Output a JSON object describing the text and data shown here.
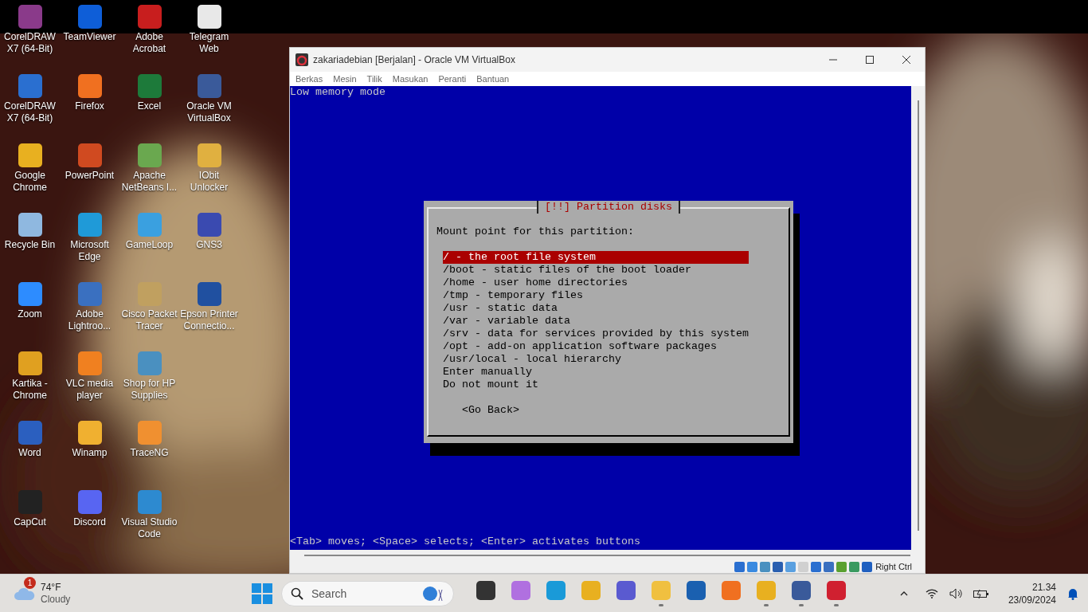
{
  "desktop_icons": [
    {
      "label": "CorelDRAW X7 (64-Bit)"
    },
    {
      "label": "CorelDRAW X7 (64-Bit)"
    },
    {
      "label": "Google Chrome"
    },
    {
      "label": "Recycle Bin"
    },
    {
      "label": "Zoom"
    },
    {
      "label": "Kartika - Chrome"
    },
    {
      "label": "Word"
    },
    {
      "label": "CapCut"
    },
    {
      "label": "TeamViewer"
    },
    {
      "label": "Firefox"
    },
    {
      "label": "PowerPoint"
    },
    {
      "label": "Microsoft Edge"
    },
    {
      "label": "Adobe Lightroo..."
    },
    {
      "label": "VLC media player"
    },
    {
      "label": "Winamp"
    },
    {
      "label": "Discord"
    },
    {
      "label": "Adobe Acrobat"
    },
    {
      "label": "Excel"
    },
    {
      "label": "Apache NetBeans I..."
    },
    {
      "label": "GameLoop"
    },
    {
      "label": "Cisco Packet Tracer"
    },
    {
      "label": "Shop for HP Supplies"
    },
    {
      "label": "TraceNG"
    },
    {
      "label": "Visual Studio Code"
    },
    {
      "label": "Telegram Web"
    },
    {
      "label": "Oracle VM VirtualBox"
    },
    {
      "label": "IObit Unlocker"
    },
    {
      "label": "GNS3"
    },
    {
      "label": "Epson Printer Connectio..."
    }
  ],
  "vm_window": {
    "title": "zakariadebian [Berjalan] - Oracle VM VirtualBox",
    "menu": [
      "Berkas",
      "Mesin",
      "Tilik",
      "Masukan",
      "Peranti",
      "Bantuan"
    ],
    "console": {
      "top_line": "Low memory mode",
      "dialog": {
        "title": "[!!] Partition disks",
        "prompt": "Mount point for this partition:",
        "options": [
          {
            "label": "/ - the root file system",
            "selected": true
          },
          {
            "label": "/boot - static files of the boot loader",
            "selected": false
          },
          {
            "label": "/home - user home directories",
            "selected": false
          },
          {
            "label": "/tmp - temporary files",
            "selected": false
          },
          {
            "label": "/usr - static data",
            "selected": false
          },
          {
            "label": "/var - variable data",
            "selected": false
          },
          {
            "label": "/srv - data for services provided by this system",
            "selected": false
          },
          {
            "label": "/opt - add-on application software packages",
            "selected": false
          },
          {
            "label": "/usr/local - local hierarchy",
            "selected": false
          },
          {
            "label": "Enter manually",
            "selected": false
          },
          {
            "label": "Do not mount it",
            "selected": false
          }
        ],
        "button": "<Go Back>"
      },
      "help_line": "<Tab> moves; <Space> selects; <Enter> activates buttons"
    },
    "status_bar": {
      "host_key": "Right Ctrl"
    }
  },
  "taskbar": {
    "weather": {
      "badge": "1",
      "temperature": "74°F",
      "condition": "Cloudy"
    },
    "search": {
      "placeholder": "Search"
    },
    "apps": [
      {
        "running": false
      },
      {
        "running": false
      },
      {
        "running": false
      },
      {
        "running": false
      },
      {
        "running": false
      },
      {
        "running": true
      },
      {
        "running": false
      },
      {
        "running": false
      },
      {
        "running": true
      },
      {
        "running": true
      },
      {
        "running": true
      }
    ],
    "clock": {
      "time": "21.34",
      "date": "23/09/2024"
    }
  }
}
